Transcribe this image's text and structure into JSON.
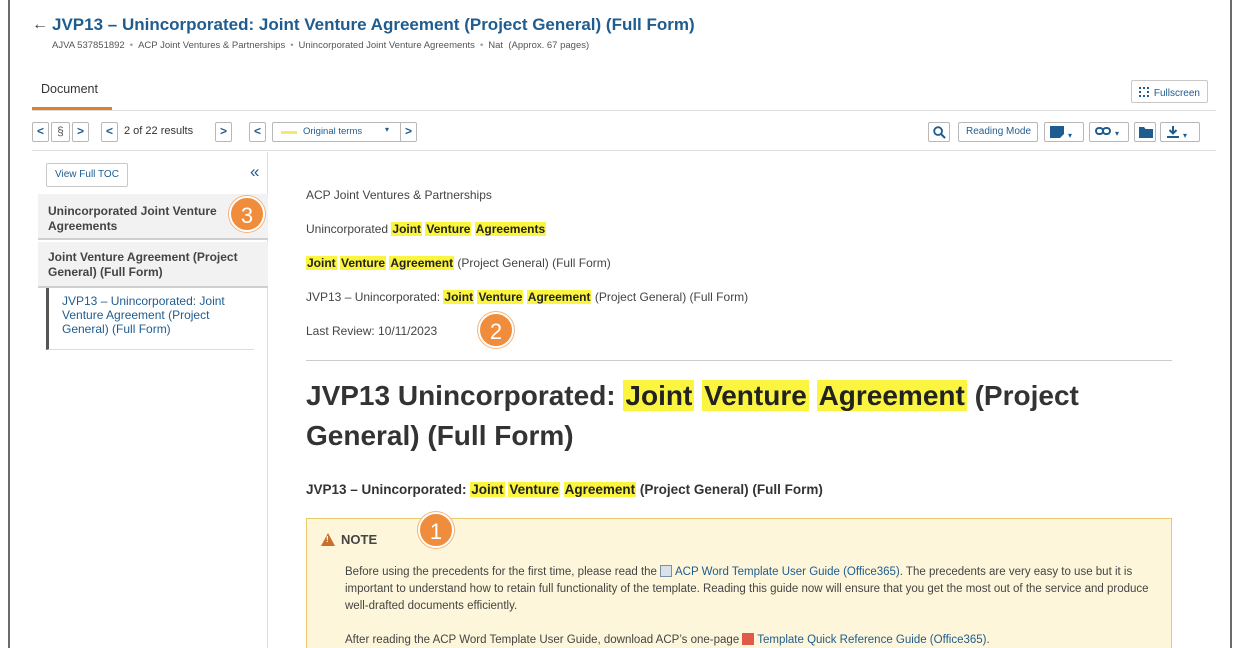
{
  "header": {
    "back": "←",
    "title": "JVP13 – Unincorporated: Joint Venture Agreement (Project General) (Full Form)",
    "meta": [
      "AJVA 537851892",
      "ACP Joint Ventures & Partnerships",
      "Unincorporated Joint Venture Agreements",
      "Nat",
      "(Approx. 67 pages)"
    ],
    "meta_sep": "•",
    "tab": "Document",
    "fullscreen": "Fullscreen"
  },
  "toolbar": {
    "prev": "<",
    "section": "§",
    "next": ">",
    "results_prev": "<",
    "results": "2 of 22 results",
    "results_next": ">",
    "terms_prev": "<",
    "terms_label": "Original terms",
    "terms_caret": "▾",
    "terms_next": ">",
    "reading_mode": "Reading Mode",
    "caret": "▾"
  },
  "sidebar": {
    "view_toc": "View Full TOC",
    "collapse": "«",
    "items": [
      "Unincorporated Joint Venture Agreements",
      "Joint Venture Agreement (Project General) (Full Form)",
      "JVP13 – Unincorporated: Joint Venture Agreement (Project General) (Full Form)"
    ]
  },
  "content": {
    "bc1": "ACP Joint Ventures & Partnerships",
    "bc2_pre": "Unincorporated ",
    "hl_joint": "Joint",
    "hl_venture": "Venture",
    "hl_agreements": "Agreements",
    "hl_agreement": "Agreement",
    "bc3_post": " (Project General) (Full Form)",
    "bc4_pre": "JVP13 – Unincorporated: ",
    "bc4_post": " (Project General) (Full Form)",
    "last_review": "Last Review: 10/11/2023",
    "big_pre": "JVP13 Unincorporated: ",
    "big_post": " (Project General) (Full Form)",
    "sub_pre": "JVP13 – Unincorporated: ",
    "sub_post": " (Project General) (Full Form)",
    "note_title": "NOTE",
    "note_p1_a": "Before using the precedents for the first time, please read the",
    "note_p1_link": "ACP Word Template User Guide (Office365)",
    "note_p1_b": ". The precedents are very easy to use but it is important to understand how to retain full functionality of the template. Reading this guide now will ensure that you get the most out of the service and produce well-drafted documents efficiently.",
    "note_p2_a": "After reading the ACP Word Template User Guide, download ACP’s one-page",
    "note_p2_link": "Template Quick Reference Guide (Office365)",
    "note_p2_b": "."
  },
  "badges": [
    "1",
    "2",
    "3"
  ],
  "colors": {
    "accent": "#1f5c8f",
    "highlight": "#fbf53f",
    "tab_underline": "#d9822b",
    "badge": "#ef8d3d",
    "note_bg": "#fdf6da"
  }
}
